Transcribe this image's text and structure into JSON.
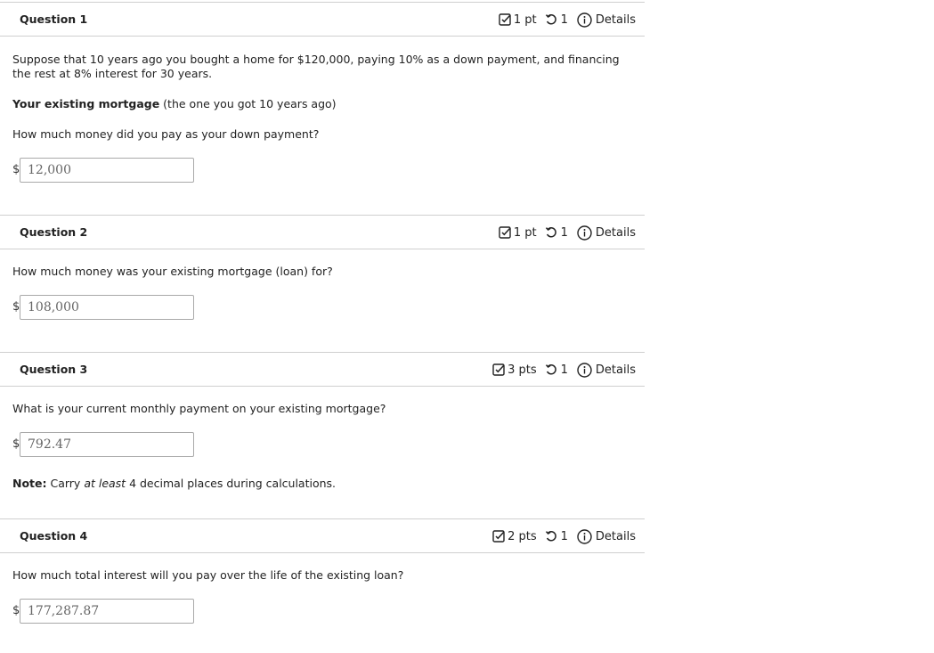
{
  "questions": [
    {
      "title": "Question 1",
      "points": "1 pt",
      "tries": "1",
      "details_label": "Details",
      "prompt_intro": "Suppose that 10 years ago you bought a home for $120,000, paying 10% as a down payment, and financing the rest at 8% interest for 30 years.",
      "section_bold": "Your existing mortgage",
      "section_rest": " (the one you got 10 years ago)",
      "prompt": "How much money did you pay as your down payment?",
      "currency": "$",
      "answer": "12,000"
    },
    {
      "title": "Question 2",
      "points": "1 pt",
      "tries": "1",
      "details_label": "Details",
      "prompt": "How much money was your existing mortgage (loan) for?",
      "currency": "$",
      "answer": "108,000"
    },
    {
      "title": "Question 3",
      "points": "3 pts",
      "tries": "1",
      "details_label": "Details",
      "prompt": "What is your current monthly payment on your existing mortgage?",
      "currency": "$",
      "answer": "792.47",
      "note_bold": "Note:",
      "note_pre": " Carry ",
      "note_em": "at least",
      "note_post": " 4 decimal places during calculations."
    },
    {
      "title": "Question 4",
      "points": "2 pts",
      "tries": "1",
      "details_label": "Details",
      "prompt": "How much total interest will you pay over the life of the existing loan?",
      "currency": "$",
      "answer": "177,287.87"
    }
  ]
}
